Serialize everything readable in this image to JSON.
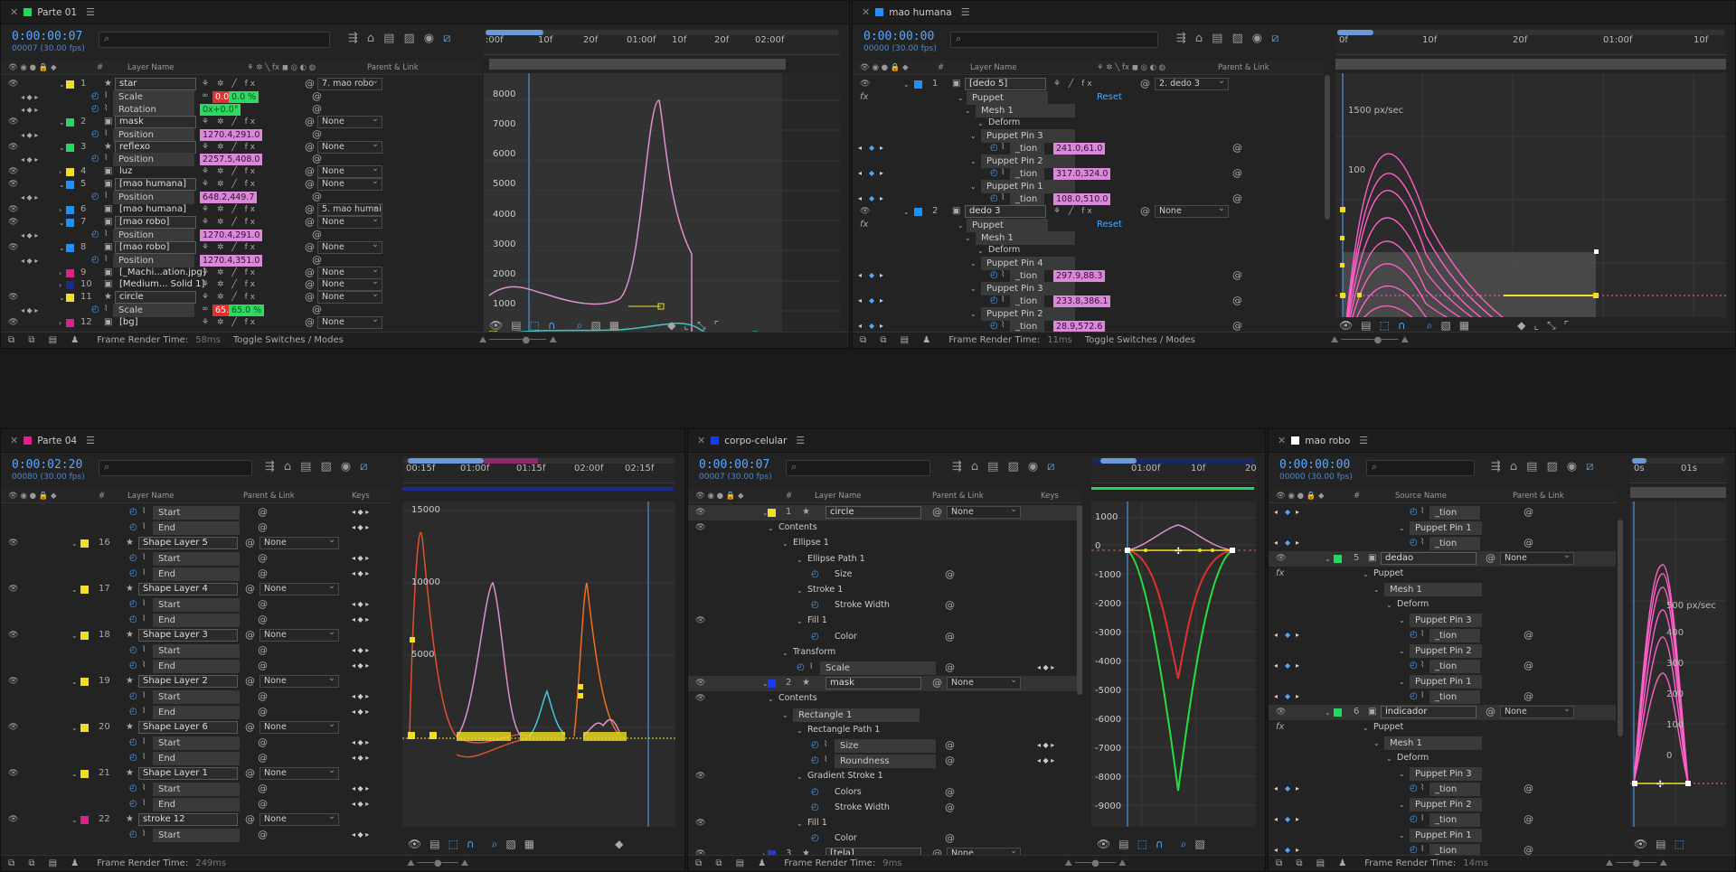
{
  "panels": {
    "p1": {
      "title": "Parte 01",
      "color": "#23d860",
      "timecode": "0:00:00:07",
      "fps": "00007 (30.00 fps)",
      "col_layer": "Layer Name",
      "col_parent": "Parent & Link",
      "ruler": [
        ":00f",
        "10f",
        "20f",
        "01:00f",
        "10f",
        "20f",
        "02:00f"
      ],
      "yticks": [
        "8000",
        "7000",
        "6000",
        "5000",
        "4000",
        "3000",
        "2000",
        "1000",
        "0",
        "-1000"
      ],
      "footer_time_label": "Frame Render Time:",
      "footer_time": "58ms",
      "toggle": "Toggle Switches / Modes",
      "rows": [
        {
          "n": "1",
          "name": "star",
          "color": "#f0e020",
          "star": true,
          "parent": "7. mao robo",
          "sel": true
        },
        {
          "prop": "Scale",
          "v1": "0.0",
          "v2": "0.0 %",
          "v1c": "red",
          "v2c": "green"
        },
        {
          "prop": "Rotation",
          "v1": "0x+0.0°",
          "v1c": "green"
        },
        {
          "n": "2",
          "name": "mask",
          "color": "#23d860",
          "parent": "None",
          "sel": true
        },
        {
          "prop": "Position",
          "v1": "1270.4,291.0"
        },
        {
          "n": "3",
          "name": "reflexo",
          "color": "#23d860",
          "star": true,
          "parent": "None",
          "sel": true
        },
        {
          "prop": "Position",
          "v1": "2257.5,408.0"
        },
        {
          "n": "4",
          "name": "luz",
          "color": "#f0e020",
          "parent": "None"
        },
        {
          "n": "5",
          "name": "[mao humana]",
          "color": "#1e90ff",
          "parent": "None",
          "sel": true
        },
        {
          "prop": "Position",
          "v1": "648.2,449.7"
        },
        {
          "n": "6",
          "name": "[mao humana]",
          "color": "#1e90ff",
          "parent": "5. mao humai"
        },
        {
          "n": "7",
          "name": "[mao robo]",
          "color": "#1e90ff",
          "parent": "None",
          "sel": true
        },
        {
          "prop": "Position",
          "v1": "1270.4,291.0"
        },
        {
          "n": "8",
          "name": "[mao robo]",
          "color": "#1e90ff",
          "parent": "None",
          "sel": true
        },
        {
          "prop": "Position",
          "v1": "1270.4,351.0"
        },
        {
          "n": "9",
          "name": "[_Machi...ation.jpg]",
          "color": "#e0208a",
          "parent": "None"
        },
        {
          "n": "10",
          "name": "[Medium... Solid 1]",
          "color": "#1a2a90",
          "parent": "None"
        },
        {
          "n": "11",
          "name": "circle",
          "color": "#f0e020",
          "star": true,
          "parent": "None",
          "sel": true
        },
        {
          "prop": "Scale",
          "v1": "65.0",
          "v2": "65.0 %",
          "v1c": "red",
          "v2c": "green"
        },
        {
          "n": "12",
          "name": "[bg]",
          "color": "#e0208a",
          "parent": "None"
        }
      ]
    },
    "p2": {
      "title": "mao humana",
      "color": "#1e90ff",
      "timecode": "0:00:00:00",
      "fps": "00000 (30.00 fps)",
      "col_layer": "Layer Name",
      "col_parent": "Parent & Link",
      "ruler": [
        "0f",
        "10f",
        "20f",
        "01:00f",
        "10f"
      ],
      "speed_label": "1500 px/sec",
      "speed_label2": "100",
      "footer_time_label": "Frame Render Time:",
      "footer_time": "11ms",
      "toggle": "Toggle Switches / Modes",
      "layer1": {
        "n": "1",
        "name": "[dedo 5]",
        "parent": "2. dedo 3"
      },
      "layer2": {
        "n": "2",
        "name": "dedo 3",
        "parent": "None"
      },
      "puppet": "Puppet",
      "reset": "Reset",
      "mesh": "Mesh 1",
      "deform": "Deform",
      "tion": "_tion",
      "pins1": [
        {
          "name": "Puppet Pin 3",
          "v": "241.0,61.0"
        },
        {
          "name": "Puppet Pin 2",
          "v": "317.0,324.0"
        },
        {
          "name": "Puppet Pin 1",
          "v": "108.0,510.0"
        }
      ],
      "pins2": [
        {
          "name": "Puppet Pin 4",
          "v": "297.9,88.3"
        },
        {
          "name": "Puppet Pin 3",
          "v": "233.8,386.1"
        },
        {
          "name": "Puppet Pin 2",
          "v": "28.9,572.6"
        },
        {
          "name": "Puppet Pin 1",
          "v": "-170.7,937.7"
        }
      ]
    },
    "p3": {
      "title": "Parte 04",
      "color": "#e0208a",
      "timecode": "0:00:02:20",
      "fps": "00080 (30.00 fps)",
      "col_layer": "Layer Name",
      "col_parent": "Parent & Link",
      "col_keys": "Keys",
      "ruler": [
        "00:15f",
        "01:00f",
        "01:15f",
        "02:00f",
        "02:15f"
      ],
      "yticks": [
        "15000",
        "10000",
        "5000"
      ],
      "footer_time_label": "Frame Render Time:",
      "footer_time": "249ms",
      "start": "Start",
      "end": "End",
      "layers": [
        {
          "n": "16",
          "name": "Shape Layer 5"
        },
        {
          "n": "17",
          "name": "Shape Layer 4"
        },
        {
          "n": "18",
          "name": "Shape Layer 3"
        },
        {
          "n": "19",
          "name": "Shape Layer 2"
        },
        {
          "n": "20",
          "name": "Shape Layer 6"
        },
        {
          "n": "21",
          "name": "Shape Layer 1"
        },
        {
          "n": "22",
          "name": "stroke 12",
          "color": "#e0208a"
        }
      ],
      "none": "None"
    },
    "p4": {
      "title": "corpo-celular",
      "color": "#1a3af0",
      "timecode": "0:00:00:07",
      "fps": "00007 (30.00 fps)",
      "col_layer": "Layer Name",
      "col_parent": "Parent & Link",
      "col_keys": "Keys",
      "ruler": [
        "01:00f",
        "10f",
        "20"
      ],
      "yticks": [
        "1000",
        "0",
        "-1000",
        "-2000",
        "-3000",
        "-4000",
        "-5000",
        "-6000",
        "-7000",
        "-8000",
        "-9000"
      ],
      "footer_time_label": "Frame Render Time:",
      "footer_time": "9ms",
      "items": [
        {
          "t": "layer",
          "n": "1",
          "name": "circle",
          "color": "#f0e020",
          "parent": "None",
          "ind": 0
        },
        {
          "t": "grp",
          "name": "Contents",
          "ind": 1
        },
        {
          "t": "grp",
          "name": "Ellipse 1",
          "ind": 2
        },
        {
          "t": "grp",
          "name": "Ellipse Path 1",
          "ind": 3
        },
        {
          "t": "p",
          "name": "Size",
          "ind": 4
        },
        {
          "t": "grp",
          "name": "Stroke 1",
          "ind": 3
        },
        {
          "t": "p",
          "name": "Stroke Width",
          "ind": 4
        },
        {
          "t": "grp",
          "name": "Fill 1",
          "ind": 3
        },
        {
          "t": "p",
          "name": "Color",
          "ind": 4
        },
        {
          "t": "grp",
          "name": "Transform",
          "ind": 2
        },
        {
          "t": "pk",
          "name": "Scale",
          "ind": 3
        },
        {
          "t": "layer",
          "n": "2",
          "name": "mask",
          "color": "#1a3af0",
          "parent": "None",
          "ind": 0
        },
        {
          "t": "grp",
          "name": "Contents",
          "ind": 1
        },
        {
          "t": "grpb",
          "name": "Rectangle 1",
          "ind": 2
        },
        {
          "t": "grp",
          "name": "Rectangle Path 1",
          "ind": 3
        },
        {
          "t": "pk",
          "name": "Size",
          "ind": 4
        },
        {
          "t": "pk",
          "name": "Roundness",
          "ind": 4
        },
        {
          "t": "grp",
          "name": "Gradient Stroke 1",
          "ind": 3
        },
        {
          "t": "p",
          "name": "Colors",
          "ind": 4
        },
        {
          "t": "p",
          "name": "Stroke Width",
          "ind": 4
        },
        {
          "t": "grp",
          "name": "Fill 1",
          "ind": 3
        },
        {
          "t": "p",
          "name": "Color",
          "ind": 4
        },
        {
          "t": "layer",
          "n": "3",
          "name": "[tela]",
          "color": "#1a3af0",
          "parent": "None",
          "ind": 0
        }
      ]
    },
    "p5": {
      "title": "mao robo",
      "color": "#ffffff",
      "timecode": "0:00:00:00",
      "fps": "00000 (30.00 fps)",
      "col_layer": "Source Name",
      "col_parent": "Parent & Link",
      "ruler": [
        "0s",
        "01s"
      ],
      "speed_label": "500 px/sec",
      "yticks2": [
        "400",
        "300",
        "200",
        "100",
        "0"
      ],
      "footer_time_label": "Frame Render Time:",
      "footer_time": "14ms",
      "tion": "_tion",
      "top_pin": "Puppet Pin 1",
      "layer5": {
        "n": "5",
        "name": "dedao",
        "parent": "None"
      },
      "layer6": {
        "n": "6",
        "name": "indicador",
        "parent": "None"
      },
      "puppet": "Puppet",
      "mesh": "Mesh 1",
      "deform": "Deform",
      "pins": [
        "Puppet Pin 3",
        "Puppet Pin 2",
        "Puppet Pin 1"
      ]
    }
  }
}
